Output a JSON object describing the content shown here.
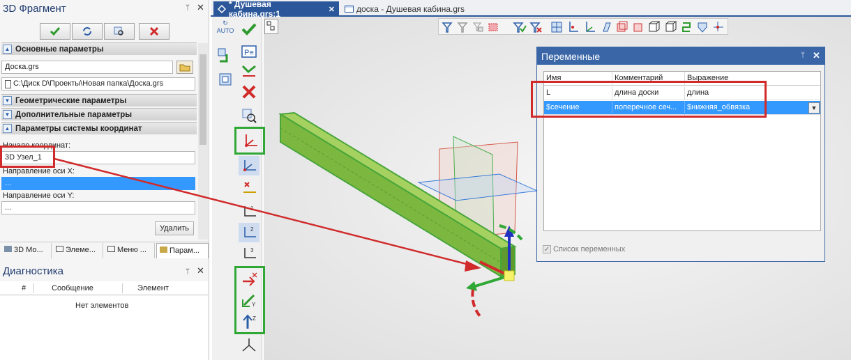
{
  "left_panel": {
    "title": "3D Фрагмент",
    "sections": {
      "main": "Основные параметры",
      "geometry": "Геометрические параметры",
      "additional": "Дополнительные параметры",
      "coord_system": "Параметры системы координат"
    },
    "file_name": "Доска.grs",
    "file_path": "C:\\Диск D\\Проекты\\Новая папка\\Доска.grs",
    "origin_label": "Начало координат:",
    "origin_value": "3D Узел_1",
    "x_dir_label": "Направление оси X:",
    "x_dir_value": "...",
    "y_dir_label": "Направление оси Y:",
    "y_dir_value": "...",
    "delete_button": "Удалить",
    "tabs": [
      "3D Мо...",
      "Элеме...",
      "Меню ...",
      "Парам..."
    ]
  },
  "diagnostics": {
    "title": "Диагностика",
    "columns": [
      "#",
      "Сообщение",
      "Элемент"
    ],
    "empty_text": "Нет элементов"
  },
  "vertical_toolbar": {
    "auto_label": "AUTO"
  },
  "doc_tabs": {
    "active": "* Душевая кабина.grs:1",
    "second": "доска - Душевая кабина.grs"
  },
  "variables_window": {
    "title": "Переменные",
    "columns": [
      "Имя",
      "Комментарий",
      "Выражение"
    ],
    "rows": [
      {
        "name": "L",
        "comment": "длина доски",
        "expression": "длина"
      },
      {
        "name": "$сечение",
        "comment": "поперечное сеч...",
        "expression": "$нижняя_обвязка"
      }
    ],
    "checkbox_label": "Список переменных",
    "checkbox_checked": true
  },
  "colors": {
    "accent": "#3a66a8",
    "selection": "#3399ff",
    "annotation_red": "#d12a2a",
    "annotation_green": "#2fa836",
    "beam_green": "#7cb840"
  }
}
